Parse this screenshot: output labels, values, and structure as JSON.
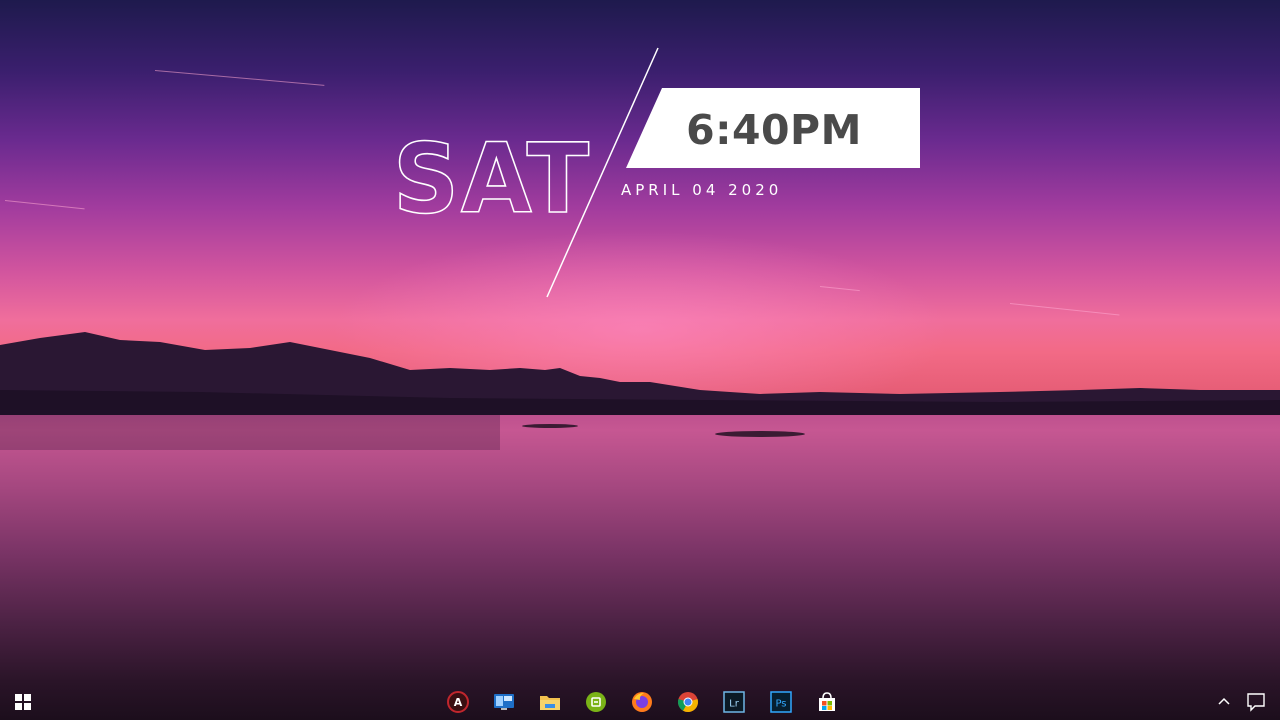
{
  "widget": {
    "day": "SAT",
    "time": "6:40PM",
    "date": "APRIL 04 2020"
  },
  "taskbar": {
    "start_icon": "windows-start-icon",
    "apps": [
      {
        "name": "app-a",
        "icon": "circle-a-icon"
      },
      {
        "name": "app-blue",
        "icon": "monitor-app-icon"
      },
      {
        "name": "file-explorer",
        "icon": "folder-icon"
      },
      {
        "name": "app-green",
        "icon": "green-circle-icon"
      },
      {
        "name": "firefox",
        "icon": "firefox-icon"
      },
      {
        "name": "chrome",
        "icon": "chrome-icon"
      },
      {
        "name": "lightroom",
        "icon": "lightroom-icon",
        "label": "Lr"
      },
      {
        "name": "photoshop",
        "icon": "photoshop-icon",
        "label": "Ps"
      },
      {
        "name": "store",
        "icon": "store-icon"
      }
    ],
    "tray": {
      "overflow_icon": "chevron-up-icon",
      "notification_icon": "notification-icon"
    }
  },
  "colors": {
    "time_box": "#ffffff",
    "time_text": "#4a4a4a",
    "accent_sky": "#f06e9c"
  }
}
